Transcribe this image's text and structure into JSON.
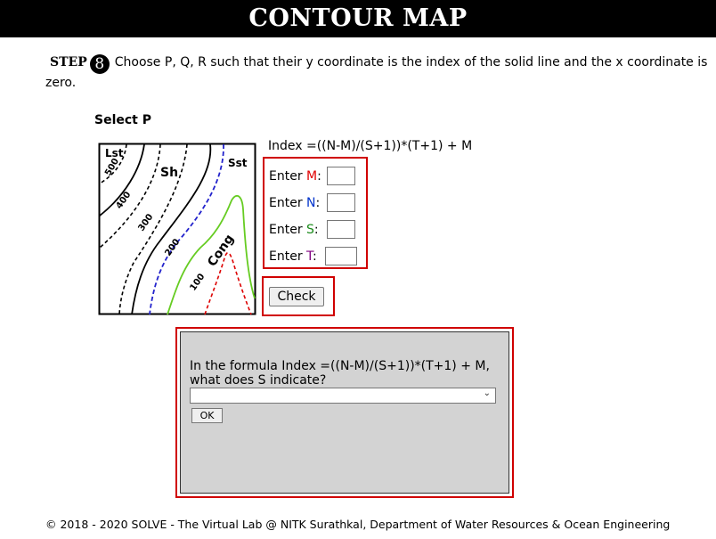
{
  "header": {
    "title": "CONTOUR MAP"
  },
  "step": {
    "label": "STEP",
    "number": "8",
    "instruction": "Choose P, Q, R such that their y coordinate is the index of the solid line and the x coordinate is zero."
  },
  "select_label": "Select P",
  "map": {
    "labels": {
      "lst": "Lst",
      "sh": "Sh",
      "sst": "Sst",
      "cong": "Cong"
    },
    "contours": [
      "500",
      "400",
      "300",
      "200",
      "100"
    ]
  },
  "formula": "Index =((N-M)/(S+1))*(T+1) + M",
  "inputs": [
    {
      "prefix": "Enter ",
      "var": "M",
      "suffix": ":",
      "value": ""
    },
    {
      "prefix": "Enter ",
      "var": "N",
      "suffix": ":",
      "value": ""
    },
    {
      "prefix": "Enter ",
      "var": "S",
      "suffix": ":",
      "value": ""
    },
    {
      "prefix": "Enter ",
      "var": "T",
      "suffix": ":",
      "value": ""
    }
  ],
  "check_button": "Check",
  "quiz": {
    "question": "In the formula Index =((N-M)/(S+1))*(T+1) + M, what does S indicate?",
    "selected": "",
    "ok_button": "OK"
  },
  "footer": "© 2018 - 2020 SOLVE - The Virtual Lab @ NITK Surathkal, Department of Water Resources & Ocean Engineering"
}
